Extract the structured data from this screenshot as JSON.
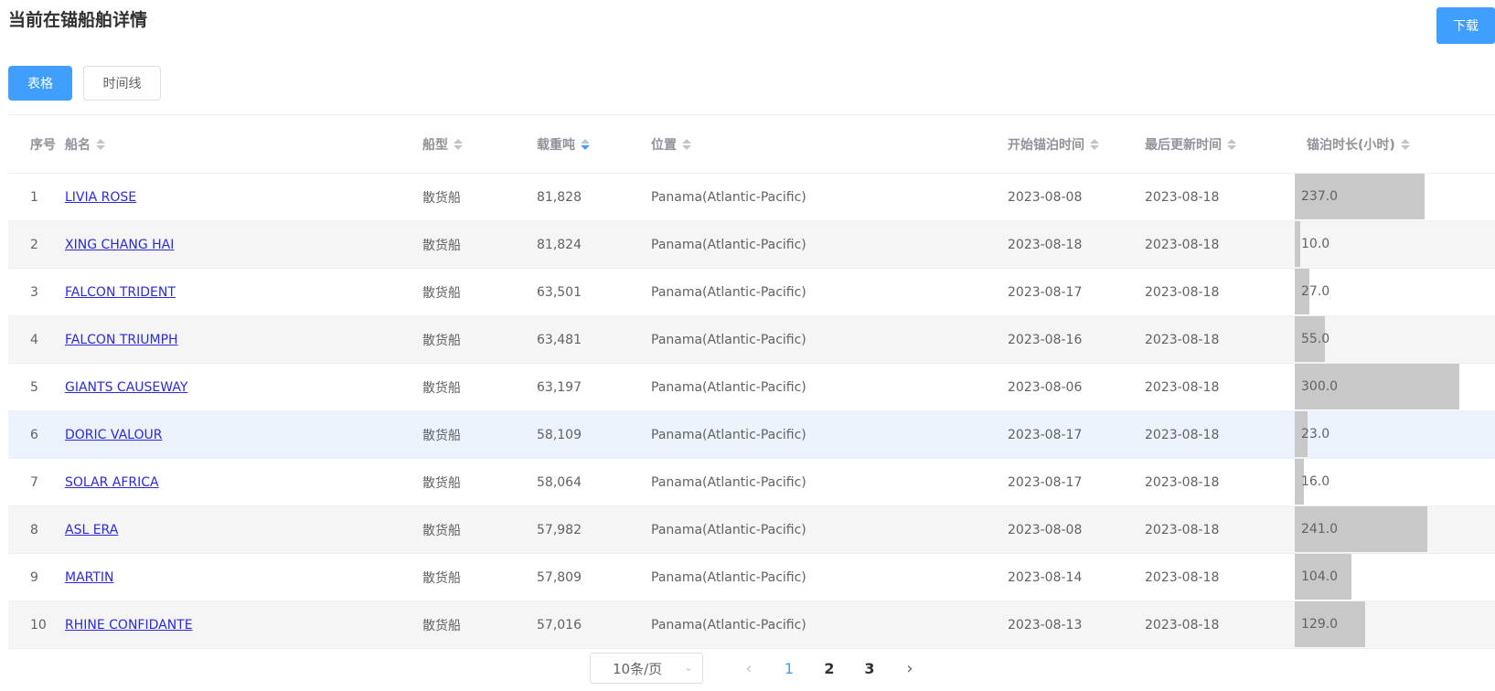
{
  "page": {
    "title": "当前在锚船舶详情",
    "download_label": "下载"
  },
  "tabs": [
    {
      "label": "表格",
      "active": true
    },
    {
      "label": "时间线",
      "active": false
    }
  ],
  "table": {
    "columns": [
      "序号",
      "船名",
      "船型",
      "载重吨",
      "位置",
      "开始锚泊时间",
      "最后更新时间",
      "锚泊时长(小时)"
    ],
    "sorted_column": "载重吨",
    "sort_direction": "descending",
    "bar_max": 300,
    "rows": [
      {
        "no": "1",
        "name": "LIVIA ROSE",
        "type": "散货船",
        "dwt": "81,828",
        "location": "Panama(Atlantic-Pacific)",
        "start": "2023-08-08",
        "updated": "2023-08-18",
        "hours": "237.0",
        "hours_value": 237
      },
      {
        "no": "2",
        "name": "XING CHANG HAI",
        "type": "散货船",
        "dwt": "81,824",
        "location": "Panama(Atlantic-Pacific)",
        "start": "2023-08-18",
        "updated": "2023-08-18",
        "hours": "10.0",
        "hours_value": 10
      },
      {
        "no": "3",
        "name": "FALCON TRIDENT",
        "type": "散货船",
        "dwt": "63,501",
        "location": "Panama(Atlantic-Pacific)",
        "start": "2023-08-17",
        "updated": "2023-08-18",
        "hours": "27.0",
        "hours_value": 27
      },
      {
        "no": "4",
        "name": "FALCON TRIUMPH",
        "type": "散货船",
        "dwt": "63,481",
        "location": "Panama(Atlantic-Pacific)",
        "start": "2023-08-16",
        "updated": "2023-08-18",
        "hours": "55.0",
        "hours_value": 55
      },
      {
        "no": "5",
        "name": "GIANTS CAUSEWAY",
        "type": "散货船",
        "dwt": "63,197",
        "location": "Panama(Atlantic-Pacific)",
        "start": "2023-08-06",
        "updated": "2023-08-18",
        "hours": "300.0",
        "hours_value": 300
      },
      {
        "no": "6",
        "name": "DORIC VALOUR",
        "type": "散货船",
        "dwt": "58,109",
        "location": "Panama(Atlantic-Pacific)",
        "start": "2023-08-17",
        "updated": "2023-08-18",
        "hours": "23.0",
        "hours_value": 23
      },
      {
        "no": "7",
        "name": "SOLAR AFRICA",
        "type": "散货船",
        "dwt": "58,064",
        "location": "Panama(Atlantic-Pacific)",
        "start": "2023-08-17",
        "updated": "2023-08-18",
        "hours": "16.0",
        "hours_value": 16
      },
      {
        "no": "8",
        "name": "ASL ERA",
        "type": "散货船",
        "dwt": "57,982",
        "location": "Panama(Atlantic-Pacific)",
        "start": "2023-08-08",
        "updated": "2023-08-18",
        "hours": "241.0",
        "hours_value": 241
      },
      {
        "no": "9",
        "name": "MARTIN",
        "type": "散货船",
        "dwt": "57,809",
        "location": "Panama(Atlantic-Pacific)",
        "start": "2023-08-14",
        "updated": "2023-08-18",
        "hours": "104.0",
        "hours_value": 104
      },
      {
        "no": "10",
        "name": "RHINE CONFIDANTE",
        "type": "散货船",
        "dwt": "57,016",
        "location": "Panama(Atlantic-Pacific)",
        "start": "2023-08-13",
        "updated": "2023-08-18",
        "hours": "129.0",
        "hours_value": 129
      }
    ]
  },
  "pagination": {
    "page_size_label": "10条/页",
    "pages": [
      "1",
      "2",
      "3"
    ],
    "current_page": "1",
    "prev_icon": "chevron-left-icon",
    "next_icon": "chevron-right-icon"
  },
  "colors": {
    "accent": "#409eff",
    "bar": "#c8c8c8",
    "link": "#2b2bd8",
    "stripe": "#f5f5f5",
    "hover_row": "#ecf3fc"
  }
}
